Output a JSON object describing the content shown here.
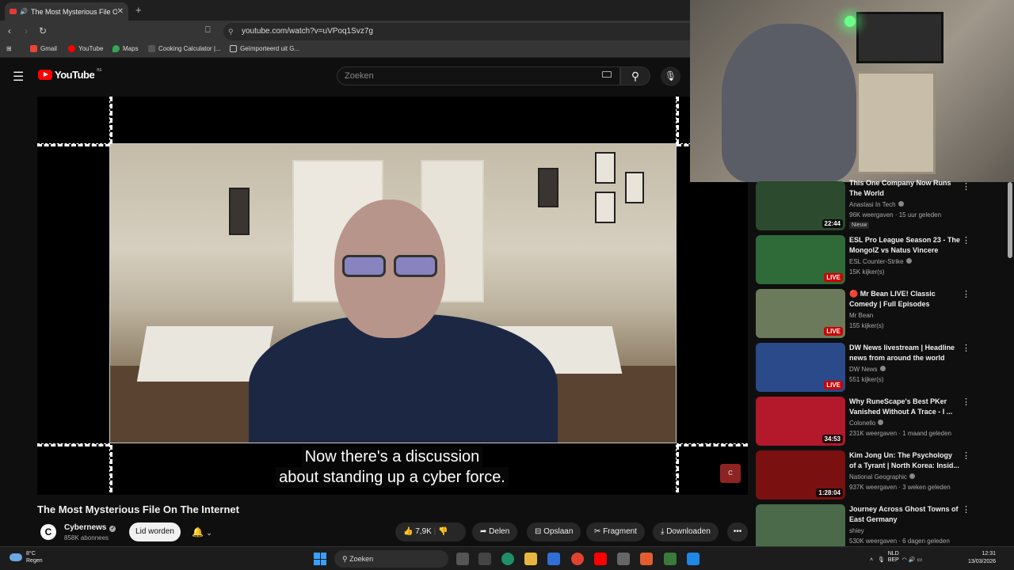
{
  "browser": {
    "tab_title": "The Most Mysterious File On",
    "url": "youtube.com/watch?v=uVPoq1Svz7g",
    "bookmarks": [
      "Gmail",
      "YouTube",
      "Maps",
      "Cooking Calculator |...",
      "Geïmporteerd uit G..."
    ]
  },
  "yt_header": {
    "logo_text": "YouTube",
    "country_code": "BE",
    "search_placeholder": "Zoeken"
  },
  "player": {
    "caption_line1": "Now there's a discussion",
    "caption_line2": "about standing up a cyber force."
  },
  "video": {
    "title": "The Most Mysterious File On The Internet",
    "channel": "Cybernews",
    "channel_initial": "C",
    "subscribers": "858K abonnees",
    "join_label": "Lid worden",
    "likes": "7,9K",
    "share_label": "Delen",
    "save_label": "Opslaan",
    "clip_label": "Fragment",
    "download_label": "Downloaden"
  },
  "recommendations": [
    {
      "title": "This One Company Now Runs The World",
      "channel": "Anastasi In Tech",
      "meta": "96K weergaven · 15 uur geleden",
      "badge": "Nieuw",
      "duration": "22:44",
      "live": false,
      "thumb_color": "#2b4a2e"
    },
    {
      "title": "ESL Pro League Season 23 - The MongolZ vs Natus Vincere",
      "channel": "ESL Counter-Strike",
      "meta": "15K kijker(s)",
      "badge": "",
      "duration": "LIVE",
      "live": true,
      "thumb_color": "#2f6b38"
    },
    {
      "title": "🔴 Mr Bean LIVE! Classic Comedy | Full Episodes",
      "channel": "Mr Bean",
      "meta": "155 kijker(s)",
      "badge": "",
      "duration": "LIVE",
      "live": true,
      "thumb_color": "#6b7a5a"
    },
    {
      "title": "DW News livestream | Headline news from around the world",
      "channel": "DW News",
      "meta": "551 kijker(s)",
      "badge": "",
      "duration": "LIVE",
      "live": true,
      "thumb_color": "#2a4a8a"
    },
    {
      "title": "Why RuneScape's Best PKer Vanished Without A Trace - I ...",
      "channel": "Colonello",
      "meta": "231K weergaven · 1 maand geleden",
      "badge": "",
      "duration": "34:53",
      "live": false,
      "thumb_color": "#b3192b"
    },
    {
      "title": "Kim Jong Un: The Psychology of a Tyrant | North Korea: Insid...",
      "channel": "National Geographic",
      "meta": "937K weergaven · 3 weken geleden",
      "badge": "",
      "duration": "1:28:04",
      "live": false,
      "thumb_color": "#7a1010"
    },
    {
      "title": "Journey Across Ghost Towns of East Germany",
      "channel": "shiey",
      "meta": "530K weergaven · 6 dagen geleden",
      "badge": "",
      "duration": "",
      "live": false,
      "thumb_color": "#4a6a4a"
    }
  ],
  "taskbar": {
    "temp": "8°C",
    "weather": "Regen",
    "search_label": "Zoeken",
    "lang1": "NLD",
    "lang2": "BEP",
    "time": "12:31",
    "date": "13/03/2026"
  },
  "colors": {
    "youtube_red": "#ff0000",
    "live_red": "#cc0000",
    "bg": "#0f0f0f"
  }
}
